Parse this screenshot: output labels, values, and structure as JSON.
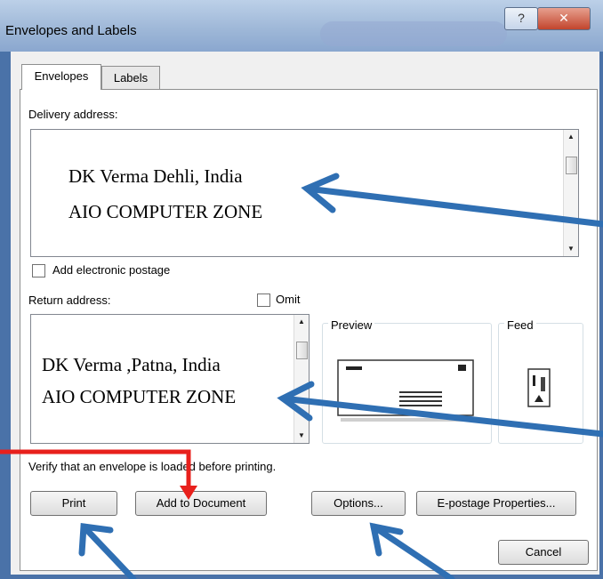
{
  "window": {
    "title": "Envelopes and Labels",
    "help_glyph": "?",
    "close_glyph": "✕"
  },
  "tabs": [
    {
      "label": "Envelopes"
    },
    {
      "label": "Labels"
    }
  ],
  "delivery": {
    "label": "Delivery address:",
    "lines": [
      "DK Verma Dehli, India",
      "AIO COMPUTER ZONE"
    ]
  },
  "electronic_postage": {
    "label": "Add electronic postage",
    "checked": false
  },
  "return_address": {
    "label": "Return address:",
    "omit_label": "Omit",
    "omit_checked": false,
    "lines": [
      "DK Verma ,Patna, India",
      "AIO COMPUTER ZONE"
    ]
  },
  "preview": {
    "label": "Preview"
  },
  "feed": {
    "label": "Feed"
  },
  "verify_text": "Verify that an envelope is loaded before printing.",
  "buttons": {
    "print": "Print",
    "add_to_document": "Add to Document",
    "options": "Options...",
    "epostage": "E-postage Properties...",
    "cancel": "Cancel"
  },
  "annotation_colors": {
    "blue_arrow": "#2f6fb3",
    "red_arrow": "#e8201c"
  }
}
